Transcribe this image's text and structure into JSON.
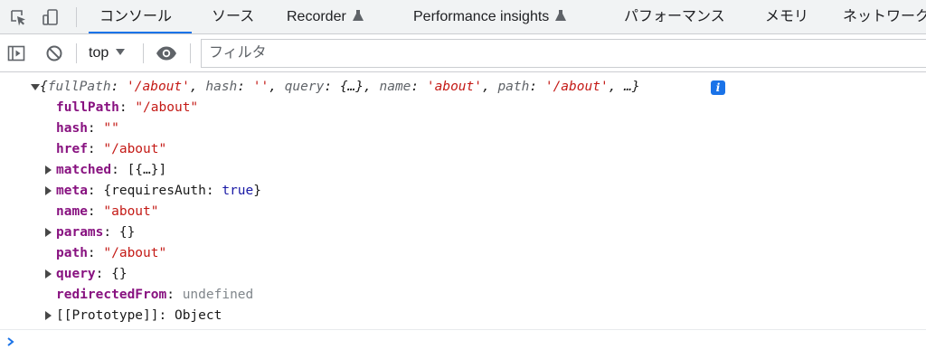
{
  "tabs": [
    {
      "label": "コンソール",
      "active": true
    },
    {
      "label": "ソース"
    },
    {
      "label": "Recorder",
      "experimental": true
    },
    {
      "label": "Performance insights",
      "experimental": true
    },
    {
      "label": "パフォーマンス"
    },
    {
      "label": "メモリ"
    },
    {
      "label": "ネットワーク"
    }
  ],
  "toolbar": {
    "context": "top",
    "filter_placeholder": "フィルタ"
  },
  "log": {
    "summary": {
      "open": "{",
      "k_fullPath": "fullPath",
      "v_fullPath": "'/about'",
      "k_hash": "hash",
      "v_hash": "''",
      "k_query": "query",
      "v_query": "{…}",
      "k_name": "name",
      "v_name": "'about'",
      "k_path": "path",
      "v_path": "'/about'",
      "tail": "…}",
      "info": "i"
    },
    "props": [
      {
        "key": "fullPath",
        "value": "\"/about\"",
        "kind": "string",
        "expandable": false
      },
      {
        "key": "hash",
        "value": "\"\"",
        "kind": "string",
        "expandable": false
      },
      {
        "key": "href",
        "value": "\"/about\"",
        "kind": "string",
        "expandable": false
      },
      {
        "key": "matched",
        "value": "[{…}]",
        "kind": "plain",
        "expandable": true
      },
      {
        "key": "meta",
        "value_prefix": "{requiresAuth: ",
        "value_kw": "true",
        "value_suffix": "}",
        "kind": "mixed",
        "expandable": true
      },
      {
        "key": "name",
        "value": "\"about\"",
        "kind": "string",
        "expandable": false
      },
      {
        "key": "params",
        "value": "{}",
        "kind": "plain",
        "expandable": true
      },
      {
        "key": "path",
        "value": "\"/about\"",
        "kind": "string",
        "expandable": false
      },
      {
        "key": "query",
        "value": "{}",
        "kind": "plain",
        "expandable": true
      },
      {
        "key": "redirectedFrom",
        "value": "undefined",
        "kind": "undefined",
        "expandable": false
      }
    ],
    "prototype": {
      "key": "[[Prototype]]",
      "value": "Object"
    }
  },
  "colors": {
    "accent": "#1a73e8",
    "key": "#881280",
    "string": "#c41a16",
    "keyword": "#1a1aa6",
    "undefined": "#80868b"
  }
}
